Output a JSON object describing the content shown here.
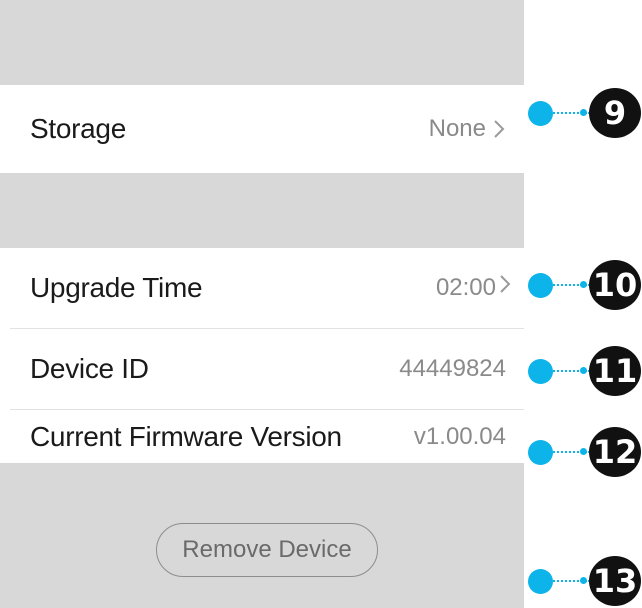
{
  "settings": {
    "storage": {
      "label": "Storage",
      "value": "None"
    },
    "upgrade_time": {
      "label": "Upgrade Time",
      "value": "02:00"
    },
    "device_id": {
      "label": "Device ID",
      "value": "44449824"
    },
    "firmware": {
      "label": "Current Firmware Version",
      "value": "v1.00.04"
    },
    "remove_button": "Remove Device"
  },
  "callouts": [
    "9",
    "10",
    "11",
    "12",
    "13"
  ],
  "colors": {
    "section_gray": "#d8d8d8",
    "callout_accent": "#0db4ea",
    "badge": "#111111"
  },
  "icons": [
    "chevron-right-icon"
  ]
}
